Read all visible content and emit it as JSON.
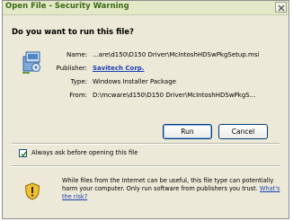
{
  "window": {
    "title": "Open File - Security Warning",
    "close_symbol": "×"
  },
  "prompt": {
    "question": "Do you want to run this file?"
  },
  "file_info": {
    "icon": "installer-package-icon",
    "fields": [
      {
        "label": "Name:",
        "value": "...are\\d150\\D150 Driver\\McIntoshHDSwPkgSetup.msi"
      },
      {
        "label": "Publisher:",
        "value": "Savitech Corp."
      },
      {
        "label": "Type:",
        "value": "Windows Installer Package"
      },
      {
        "label": "From:",
        "value": "D:\\mcware\\d150\\D150 Driver\\McIntoshHDSwPkgS..."
      }
    ]
  },
  "buttons": {
    "run": "Run",
    "cancel": "Cancel"
  },
  "checkbox": {
    "label": "Always ask before opening this file",
    "checked": true
  },
  "warning": {
    "icon": "security-shield-warning-icon",
    "text": "While files from the Internet can be useful, this file type can potentially harm your computer. Only run software from publishers you trust.",
    "link": "What's the risk?"
  },
  "colors": {
    "title": "#3b6b15",
    "link": "#1a3fb0",
    "background": "#ece9d8"
  }
}
